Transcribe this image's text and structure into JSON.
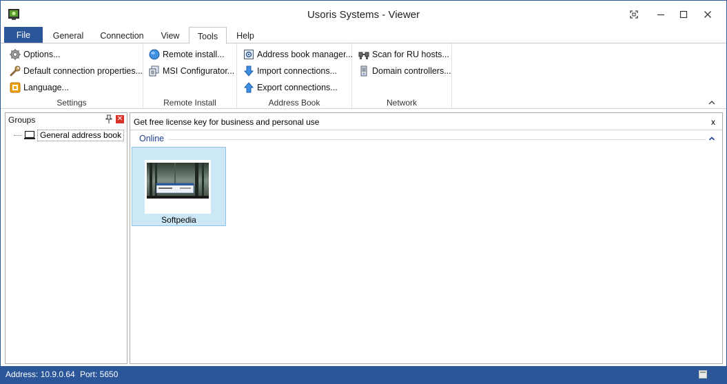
{
  "window": {
    "title": "Usoris Systems - Viewer"
  },
  "tabs": [
    {
      "label": "File"
    },
    {
      "label": "General"
    },
    {
      "label": "Connection"
    },
    {
      "label": "View"
    },
    {
      "label": "Tools"
    },
    {
      "label": "Help"
    }
  ],
  "ribbon": {
    "settings": {
      "label": "Settings",
      "items": [
        "Options...",
        "Default connection properties...",
        "Language..."
      ]
    },
    "remote_install": {
      "label": "Remote Install",
      "items": [
        "Remote install...",
        "MSI Configurator..."
      ]
    },
    "address_book": {
      "label": "Address Book",
      "items": [
        "Address book manager...",
        "Import connections...",
        "Export connections..."
      ]
    },
    "network": {
      "label": "Network",
      "items": [
        "Scan for RU hosts...",
        "Domain controllers..."
      ]
    }
  },
  "groups_pane": {
    "title": "Groups",
    "tree": [
      "General address book"
    ]
  },
  "main": {
    "banner": "Get free license key for business and personal use",
    "banner_close": "x",
    "section": "Online",
    "tiles": [
      {
        "label": "Softpedia"
      }
    ]
  },
  "status": {
    "address": "Address: 10.9.0.64",
    "port": "Port: 5650"
  },
  "colors": {
    "accent": "#2b579a",
    "tile_selected": "#cce8f7",
    "section_title": "#1e3f8a"
  }
}
